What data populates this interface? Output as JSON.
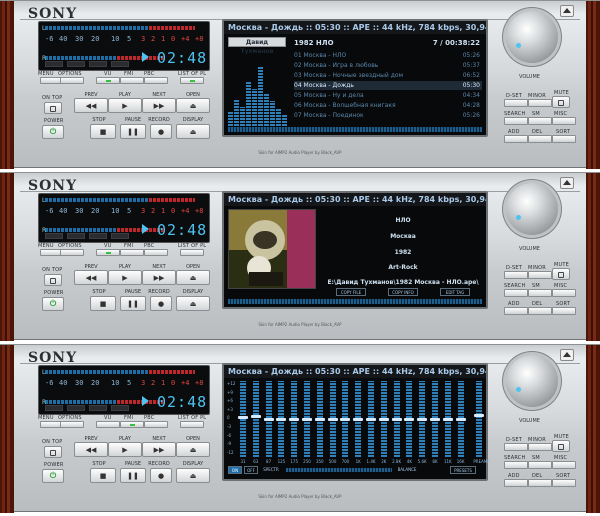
{
  "brand": "SONY",
  "time": "02:48",
  "db_scale": [
    "-6",
    "40",
    "30",
    "20",
    "10",
    "5",
    "3",
    "2",
    "1",
    "0",
    "+4",
    "+8"
  ],
  "lcd_buttons": [
    "MENU",
    "OPTIONS",
    "VU",
    "FMI",
    "PBC",
    "LIST OF PL"
  ],
  "transport": {
    "prev": "PREV",
    "play": "PLAY",
    "next": "NEXT",
    "open": "OPEN",
    "stop": "STOP",
    "pause": "PAUSE",
    "record": "RECORD",
    "display": "DISPLAY"
  },
  "on_top": "ON TOP",
  "power": "POWER",
  "volume": "VOLUME",
  "right_buttons": {
    "dset": "D-SET",
    "mnor": "MINOR",
    "mute": "MUTE",
    "search": "SEARCH",
    "sm": "SM",
    "misc": "MISC",
    "add": "ADD",
    "del": "DEL",
    "sort": "SORT"
  },
  "status_line": "Москва - Дождь :: 05:30 :: APE :: 44 kHz, 784 kbps, 30,94 MB ::",
  "footer": "Skin for AIMP2 Audio Player by Black_AVP",
  "playlist": {
    "tab": "Давид Тухманов",
    "album": "1982 НЛО",
    "count": "7 / 00:38:22",
    "items": [
      {
        "title": "01 Москва - НЛО",
        "dur": "05:26"
      },
      {
        "title": "02 Москва - Игра в любовь",
        "dur": "05:37"
      },
      {
        "title": "03 Москва - Ночные звездный дом",
        "dur": "06:52"
      },
      {
        "title": "04 Москва - Дождь",
        "dur": "05:30",
        "sel": true
      },
      {
        "title": "05 Москва - Ну и дела",
        "dur": "04:34"
      },
      {
        "title": "06 Москва - Волшебная книгакя",
        "dur": "04:28"
      },
      {
        "title": "07 Москва - Поединок",
        "dur": "05:26"
      }
    ]
  },
  "info": {
    "artist": "НЛО",
    "album": "Москва",
    "year": "1982",
    "genre": "Art-Rock",
    "path": "E:\\Давид Тухманов\\1982 Москва - НЛО.ape\\",
    "buttons": [
      "COPY FILE",
      "COPY INFO",
      "EDIT TAG"
    ]
  },
  "eq": {
    "db_labels": [
      "+12",
      "+9",
      "+6",
      "+3",
      "0",
      "-3",
      "-6",
      "-9",
      "-12"
    ],
    "bands": [
      "31",
      "63",
      "87",
      "125",
      "175",
      "250",
      "350",
      "500",
      "700",
      "1K",
      "1.4K",
      "2K",
      "2.8K",
      "4K",
      "5.6K",
      "8K",
      "11K",
      "16K",
      "PREAMP"
    ],
    "levels": [
      0.52,
      0.53,
      0.5,
      0.5,
      0.5,
      0.5,
      0.5,
      0.5,
      0.5,
      0.5,
      0.5,
      0.5,
      0.5,
      0.5,
      0.5,
      0.5,
      0.5,
      0.5,
      0.55
    ],
    "buttons": [
      "ON",
      "OFF",
      "SPECTR",
      "BALANCE",
      "PRESETS"
    ]
  }
}
